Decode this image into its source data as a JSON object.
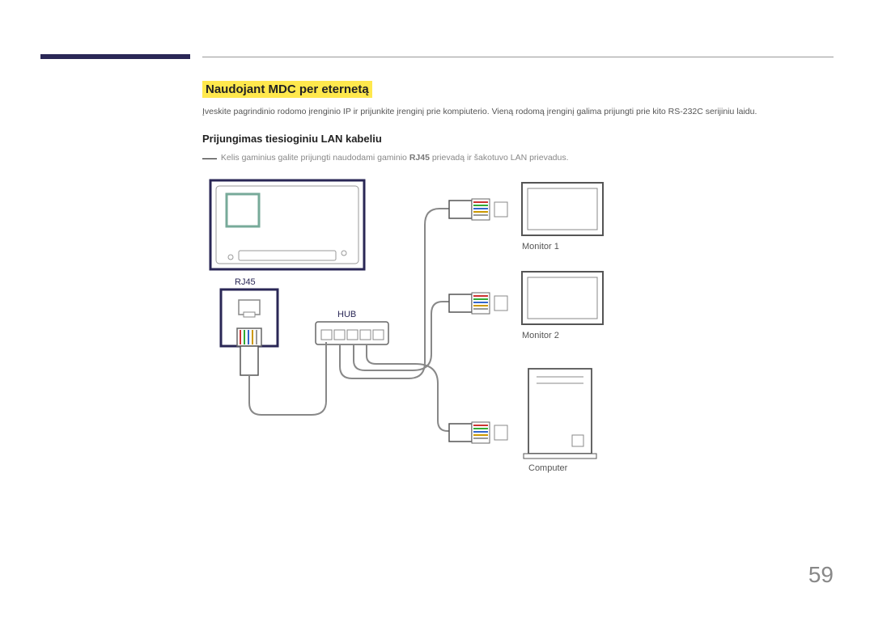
{
  "section_title": "Naudojant MDC per eternetą",
  "intro_text": "Įveskite pagrindinio rodomo įrenginio IP ir prijunkite įrenginį prie kompiuterio. Vieną rodomą įrenginį galima prijungti prie kito RS-232C serijiniu laidu.",
  "sub_title": "Prijungimas tiesioginiu LAN kabeliu",
  "note": {
    "prefix": "Kelis gaminius galite prijungti naudodami gaminio ",
    "strong": "RJ45",
    "suffix": " prievadą ir šakotuvo LAN prievadus."
  },
  "labels": {
    "rj45": "RJ45",
    "hub": "HUB",
    "monitor1": "Monitor 1",
    "monitor2": "Monitor 2",
    "computer": "Computer"
  },
  "page_number": "59"
}
